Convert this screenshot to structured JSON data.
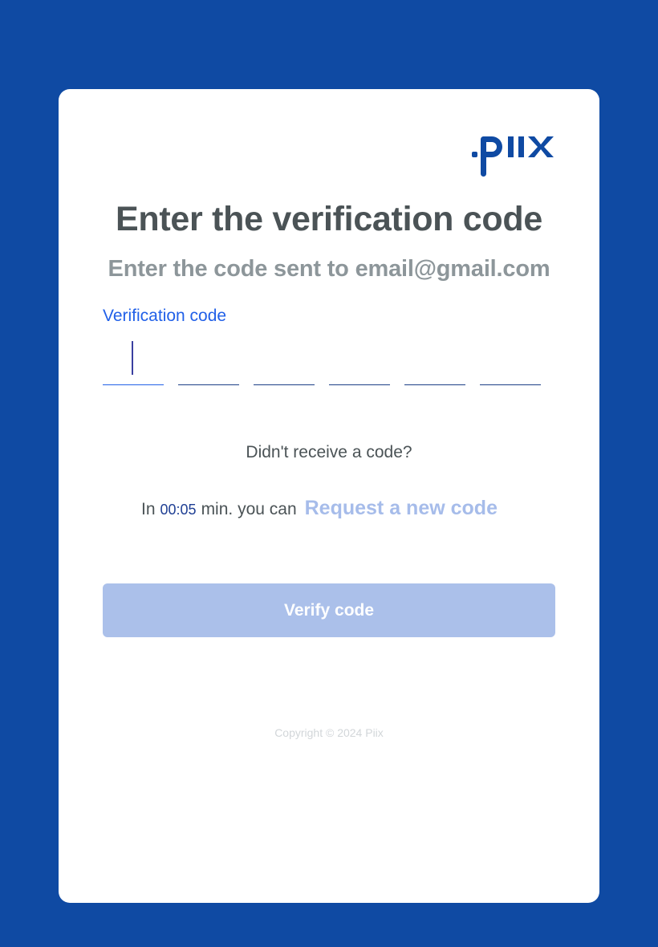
{
  "brand": {
    "logo_text": "Piix",
    "color": "#0f4aa3"
  },
  "page": {
    "background": "#0f4aa3"
  },
  "header": {
    "title": "Enter the verification code",
    "subtitle_prefix": "Enter the code sent to",
    "email": "email@gmail.com"
  },
  "form": {
    "code_label": "Verification code",
    "digits": [
      "",
      "",
      "",
      "",
      "",
      ""
    ],
    "active_digit": 1
  },
  "resend": {
    "question": "Didn't receive a code?",
    "timer_prefix": "In",
    "timer_value": "00:05",
    "timer_suffix": "min. you can",
    "request_link": "Request a new code"
  },
  "actions": {
    "verify_label": "Verify code"
  },
  "footer": {
    "copyright": "Copyright © 2024 Piix"
  }
}
